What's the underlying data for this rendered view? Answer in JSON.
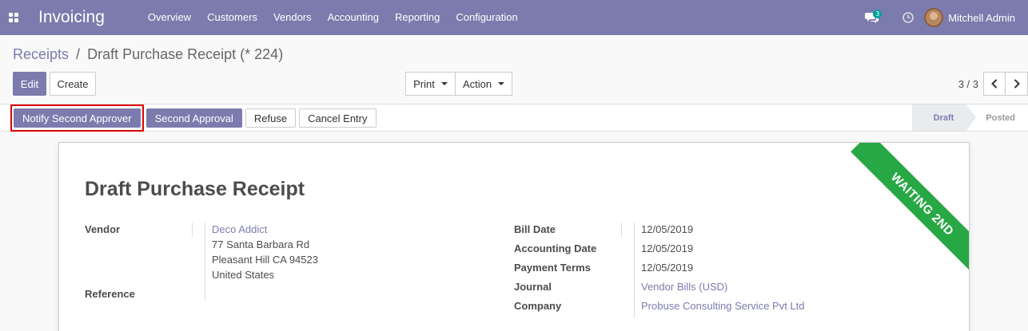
{
  "navbar": {
    "app_title": "Invoicing",
    "menu": [
      "Overview",
      "Customers",
      "Vendors",
      "Accounting",
      "Reporting",
      "Configuration"
    ],
    "chat_count": "3",
    "user_name": "Mitchell Admin",
    "icons": [
      "apps-grid-icon",
      "chat-icon",
      "clock-icon"
    ]
  },
  "breadcrumb": {
    "parent": "Receipts",
    "separator": "/",
    "current": "Draft Purchase Receipt (* 224)"
  },
  "toolbar": {
    "edit_label": "Edit",
    "create_label": "Create",
    "print_label": "Print",
    "action_label": "Action"
  },
  "pager": {
    "value": "3 / 3"
  },
  "statusbar": {
    "buttons": [
      "Notify Second Approver",
      "Second Approval",
      "Refuse",
      "Cancel Entry"
    ],
    "stages": [
      "Draft",
      "Posted"
    ],
    "active_stage": "Draft"
  },
  "form": {
    "ribbon": "WAITING 2ND",
    "title": "Draft Purchase Receipt",
    "vendor_label": "Vendor",
    "vendor_name": "Deco Addict",
    "vendor_address": [
      "77 Santa Barbara Rd",
      "Pleasant Hill CA 94523",
      "United States"
    ],
    "reference_label": "Reference",
    "bill_date_label": "Bill Date",
    "bill_date": "12/05/2019",
    "accounting_date_label": "Accounting Date",
    "accounting_date": "12/05/2019",
    "payment_terms_label": "Payment Terms",
    "payment_terms": "12/05/2019",
    "journal_label": "Journal",
    "journal": "Vendor Bills (USD)",
    "company_label": "Company",
    "company": "Probuse Consulting Service Pvt Ltd"
  },
  "colors": {
    "brand": "#7c7bad",
    "ribbon": "#28a745",
    "highlight_border": "#dd0000",
    "badge": "#00a09d"
  }
}
